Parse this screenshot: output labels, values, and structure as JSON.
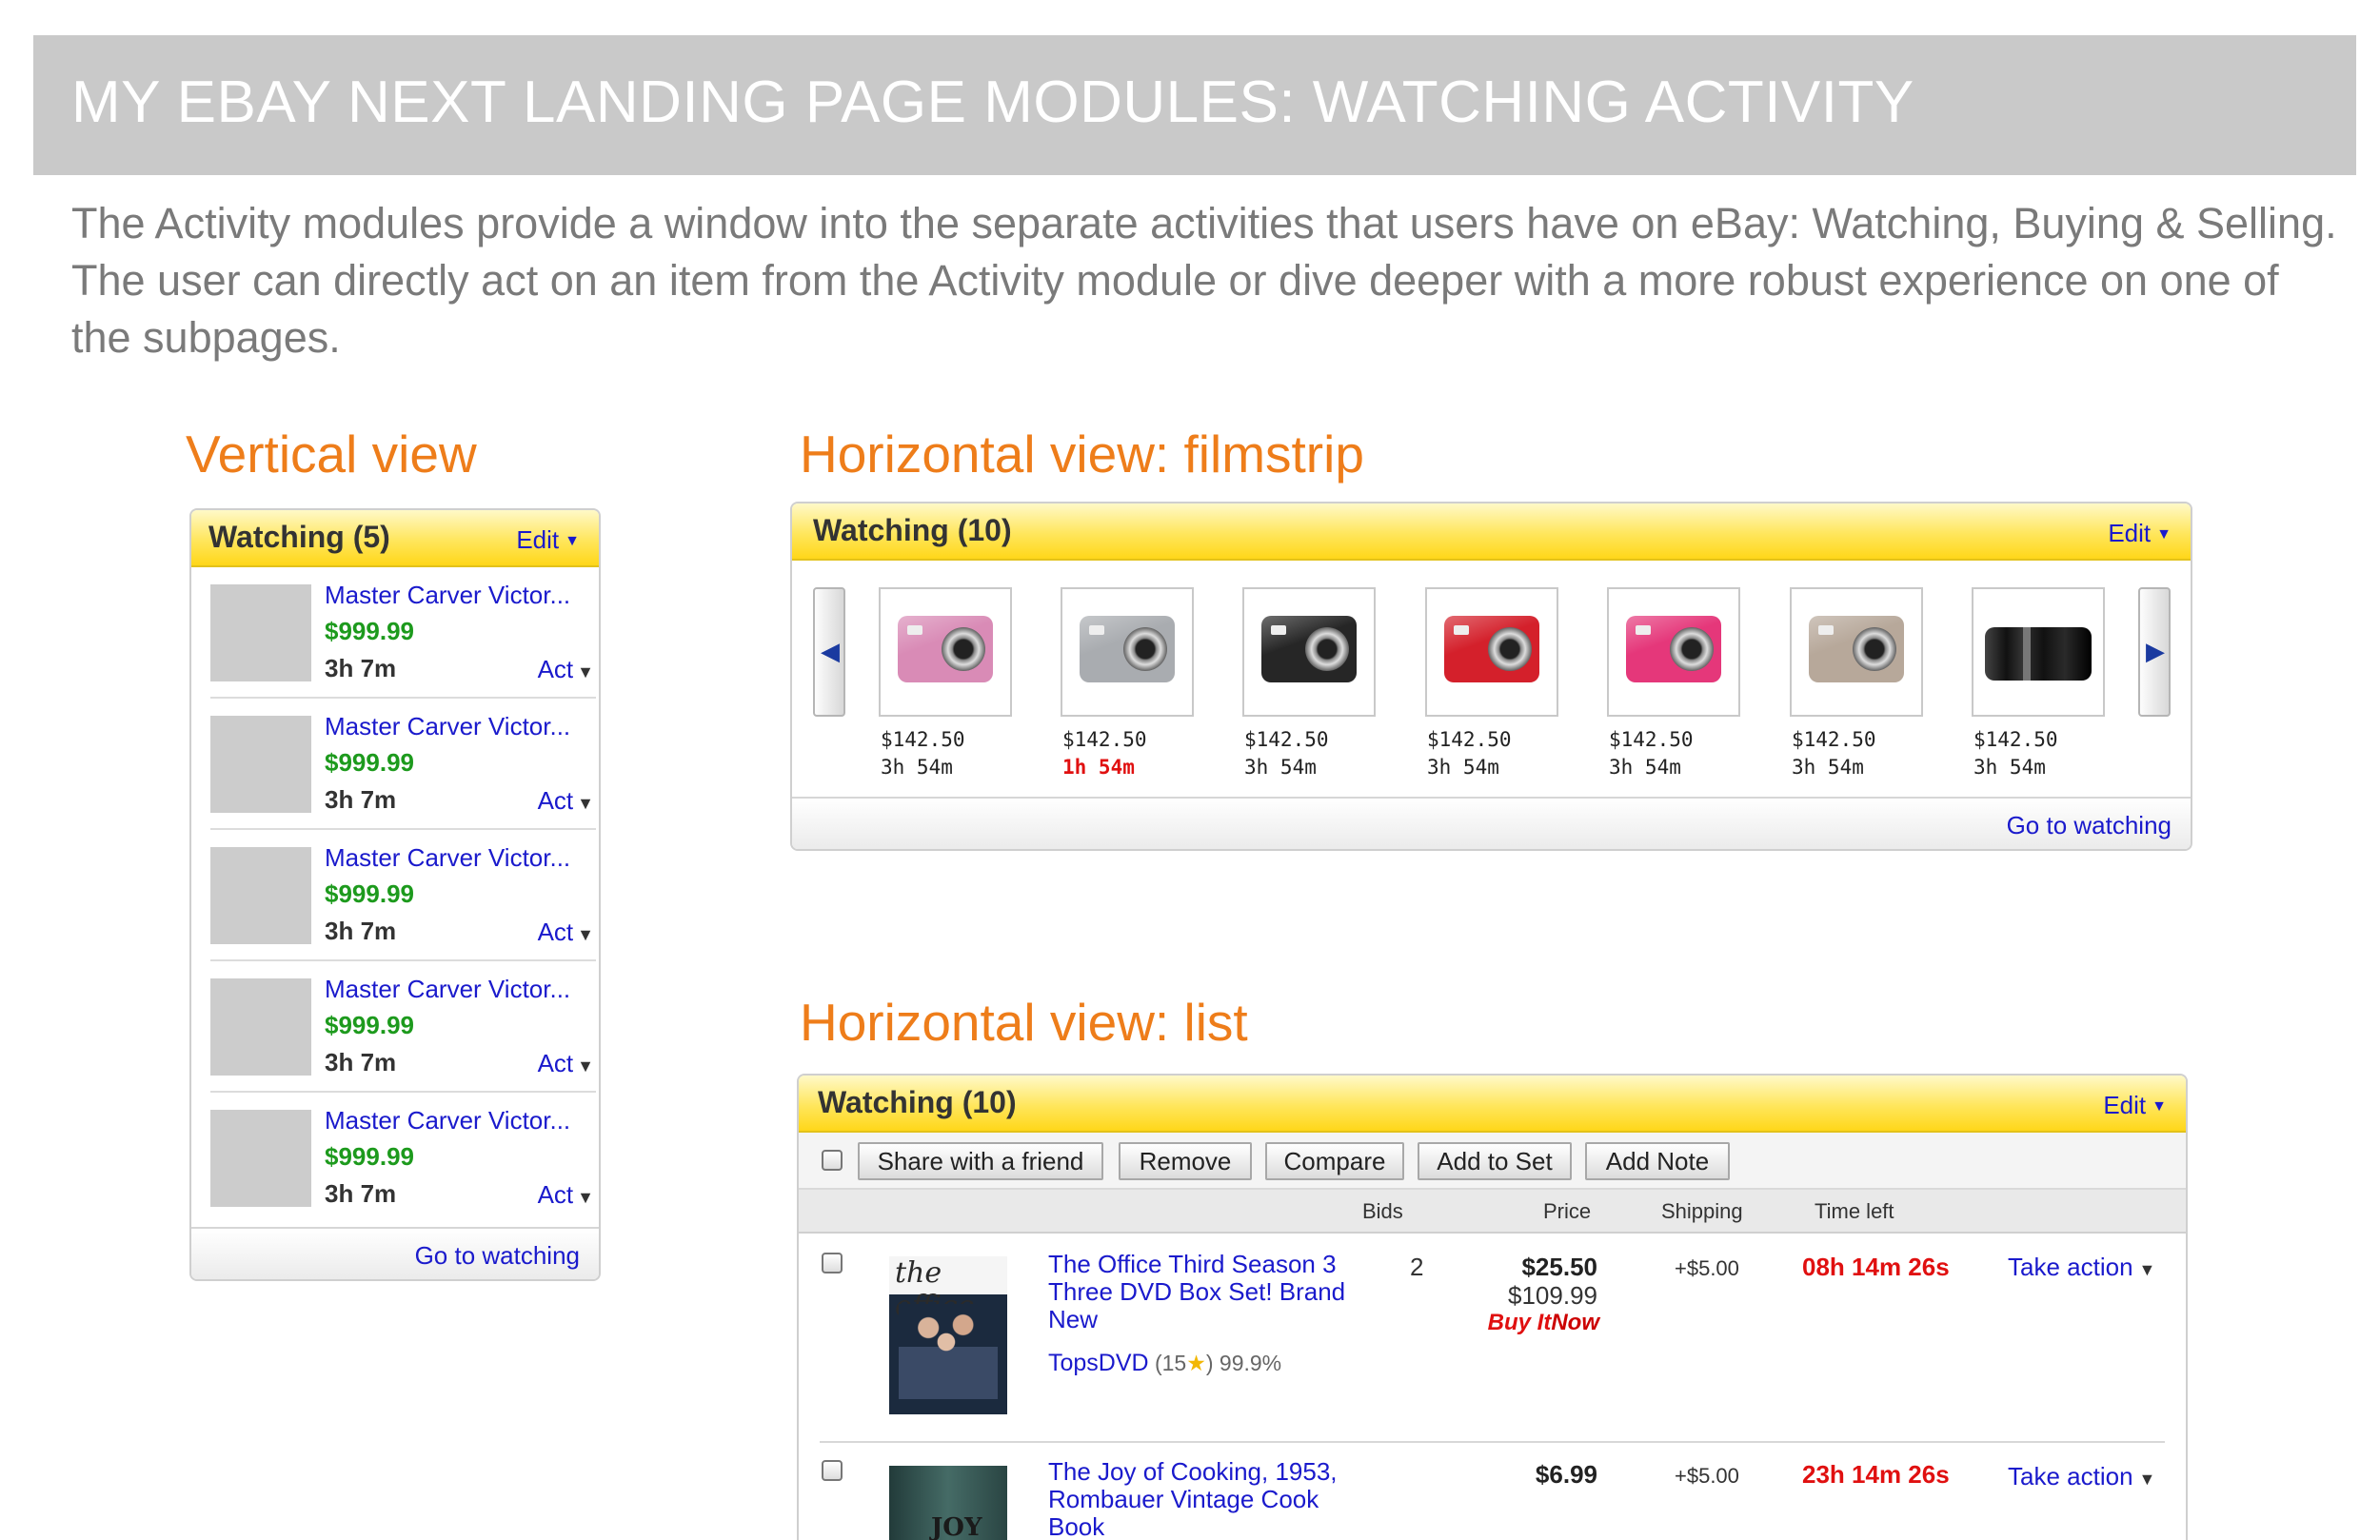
{
  "banner": {
    "title": "MY EBAY NEXT LANDING PAGE MODULES: WATCHING ACTIVITY"
  },
  "intro": "The Activity modules provide a window into the separate activities that users have on eBay: Watching, Buying & Selling. The user can directly act on an item from the Activity module or dive deeper with a more robust experience on one of the subpages.",
  "vertical": {
    "section_title": "Vertical view",
    "header": "Watching (5)",
    "edit": "Edit",
    "items": [
      {
        "name": "Master Carver Victor...",
        "price": "$999.99",
        "time": "3h 7m",
        "action": "Act"
      },
      {
        "name": "Master Carver Victor...",
        "price": "$999.99",
        "time": "3h 7m",
        "action": "Act"
      },
      {
        "name": "Master Carver Victor...",
        "price": "$999.99",
        "time": "3h 7m",
        "action": "Act"
      },
      {
        "name": "Master Carver Victor...",
        "price": "$999.99",
        "time": "3h 7m",
        "action": "Act"
      },
      {
        "name": "Master Carver Victor...",
        "price": "$999.99",
        "time": "3h 7m",
        "action": "Act"
      }
    ],
    "footer_link": "Go to watching"
  },
  "filmstrip": {
    "section_title": "Horizontal view: filmstrip",
    "header": "Watching (10)",
    "edit": "Edit",
    "items": [
      {
        "price": "$142.50",
        "time": "3h 54m",
        "urgent": false,
        "camera_color": "#d98bb6"
      },
      {
        "price": "$142.50",
        "time": "1h 54m",
        "urgent": true,
        "camera_color": "#a9acb0"
      },
      {
        "price": "$142.50",
        "time": "3h 54m",
        "urgent": false,
        "camera_color": "#262626"
      },
      {
        "price": "$142.50",
        "time": "3h 54m",
        "urgent": false,
        "camera_color": "#d4202b"
      },
      {
        "price": "$142.50",
        "time": "3h 54m",
        "urgent": false,
        "camera_color": "#e5377a"
      },
      {
        "price": "$142.50",
        "time": "3h 54m",
        "urgent": false,
        "camera_color": "#b7a89a"
      },
      {
        "price": "$142.50",
        "time": "3h 54m",
        "urgent": false,
        "camera_color": "#1a1a1a"
      }
    ],
    "prev_icon": "left-arrow-icon",
    "next_icon": "right-arrow-icon",
    "footer_link": "Go to watching"
  },
  "list": {
    "section_title": "Horizontal view: list",
    "header": "Watching (10)",
    "edit": "Edit",
    "toolbar": {
      "share": "Share with a friend",
      "remove": "Remove",
      "compare": "Compare",
      "add_to_set": "Add to Set",
      "add_note": "Add Note"
    },
    "columns": {
      "bids": "Bids",
      "price": "Price",
      "shipping": "Shipping",
      "time_left": "Time left"
    },
    "rows": [
      {
        "title": "The Office Third Season 3 Three DVD Box Set! Brand New",
        "seller": "TopsDVD",
        "feedback_open": "(15",
        "feedback_close": ")",
        "rating": "99.9%",
        "bids": "2",
        "price": "$25.50",
        "orig_price": "$109.99",
        "bin_buy": "Buy It",
        "bin_now": "Now",
        "shipping": "+$5.00",
        "time_left": "08h 14m 26s",
        "action": "Take action",
        "cover_logo": "the office"
      },
      {
        "title": "The Joy of Cooking, 1953, Rombauer Vintage Cook Book",
        "price": "$6.99",
        "shipping": "+$5.00",
        "time_left": "23h 14m 26s",
        "action": "Take action",
        "cover_text": "JOY"
      }
    ]
  },
  "colors": {
    "accent_orange": "#ee7d1a",
    "link_blue": "#1a1acc",
    "price_green": "#1d9a1d",
    "urgent_red": "#e01010",
    "header_yellow": "#ffd719"
  }
}
